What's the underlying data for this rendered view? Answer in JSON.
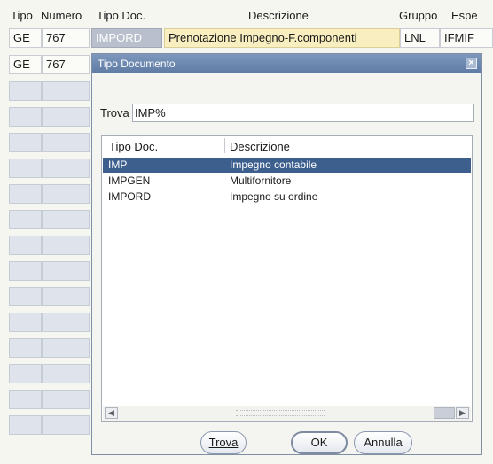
{
  "form": {
    "headers": [
      "Tipo",
      "Numero",
      "Tipo Doc.",
      "Descrizione",
      "Gruppo",
      "Espe"
    ],
    "row1": {
      "tipo": "GE",
      "numero": "767",
      "tipo_doc": "IMPORD",
      "descrizione": "Prenotazione Impegno-F.componenti",
      "gruppo": "LNL",
      "esperimento": "IFMIF"
    },
    "row2": {
      "tipo": "GE",
      "numero": "767"
    }
  },
  "dialog": {
    "title": "Tipo Documento",
    "close_icon": "close-icon",
    "find_label": "Trova",
    "find_value": "IMP%",
    "list": {
      "columns": [
        "Tipo Doc.",
        "Descrizione"
      ],
      "rows": [
        {
          "code": "IMP",
          "desc": "Impegno contabile"
        },
        {
          "code": "IMPGEN",
          "desc": "Multifornitore"
        },
        {
          "code": "IMPORD",
          "desc": "Impegno su ordine"
        }
      ],
      "selected_index": 0
    },
    "buttons": {
      "find": "Trova",
      "ok": "OK",
      "cancel": "Annulla"
    }
  },
  "colors": {
    "selection": "#3d5f8e",
    "titlebar": "#6f89b2",
    "highlight_cell": "#f8eec0"
  }
}
